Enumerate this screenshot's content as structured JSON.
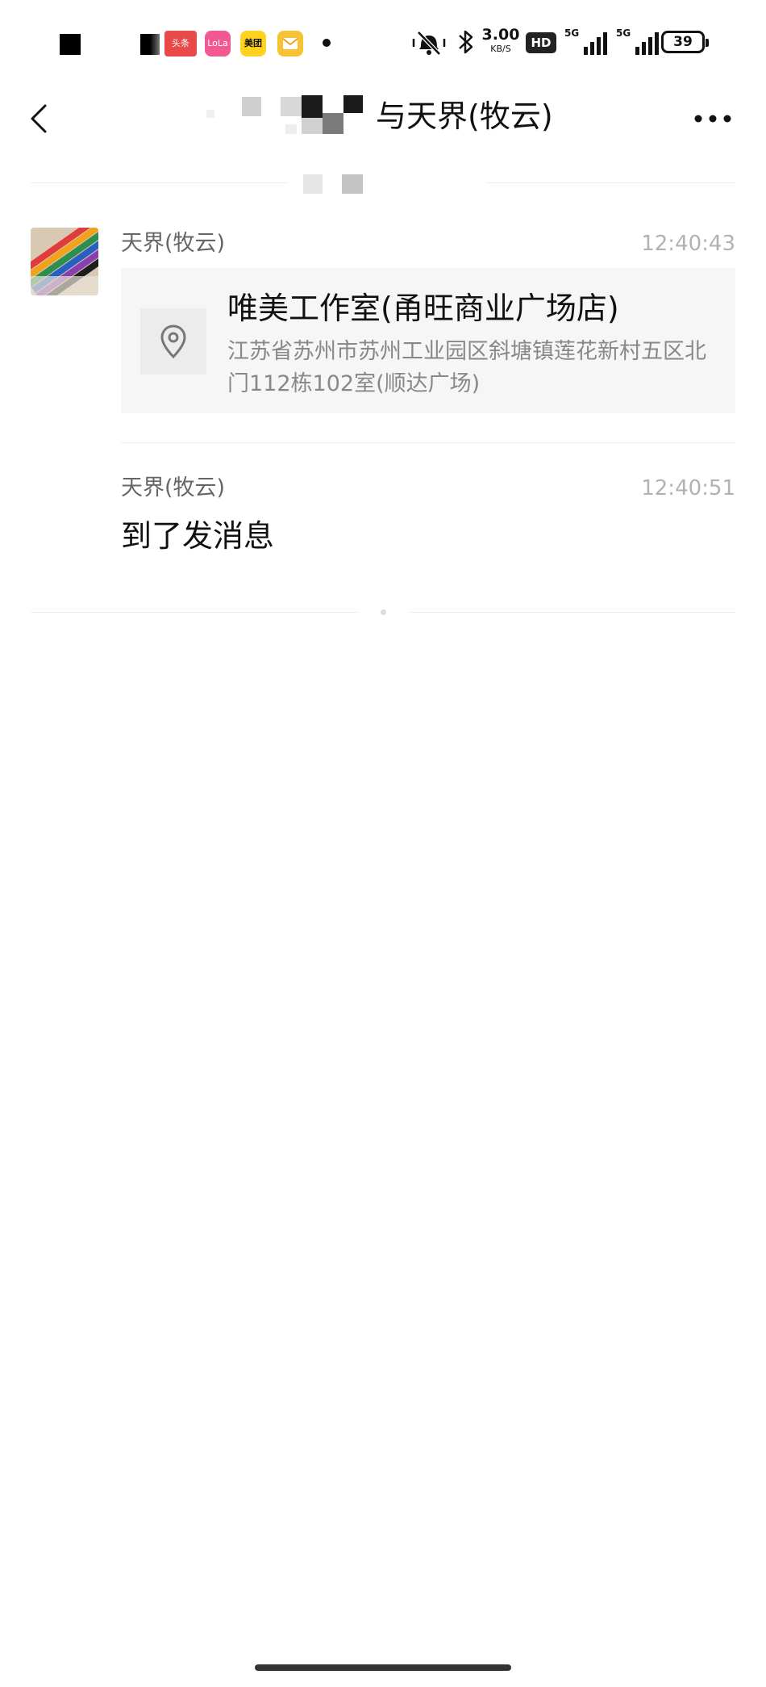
{
  "status_bar": {
    "app_badges": [
      "头条",
      "LoLa",
      "美团"
    ],
    "net_speed_value": "3.00",
    "net_speed_unit": "KB/S",
    "hd_label": "HD",
    "signal1_label": "5G",
    "signal2_label": "5G",
    "battery_level": "39"
  },
  "header": {
    "title_visible": "与天界(牧云)",
    "back_icon": "chevron-left-icon",
    "more_icon": "more-horizontal-icon"
  },
  "messages": [
    {
      "sender": "天界(牧云)",
      "time": "12:40:43",
      "type": "location",
      "location_name": "唯美工作室(甬旺商业广场店)",
      "location_address": "江苏省苏州市苏州工业园区斜塘镇莲花新村五区北门112栋102室(顺达广场)",
      "location_icon": "map-pin-icon"
    },
    {
      "sender": "天界(牧云)",
      "time": "12:40:51",
      "type": "text",
      "text": "到了发消息"
    }
  ],
  "colors": {
    "background": "#ffffff",
    "divider": "#eeeeee",
    "sender_text": "#666666",
    "time_text": "#b2b2b2",
    "card_bg": "#f6f6f6"
  }
}
